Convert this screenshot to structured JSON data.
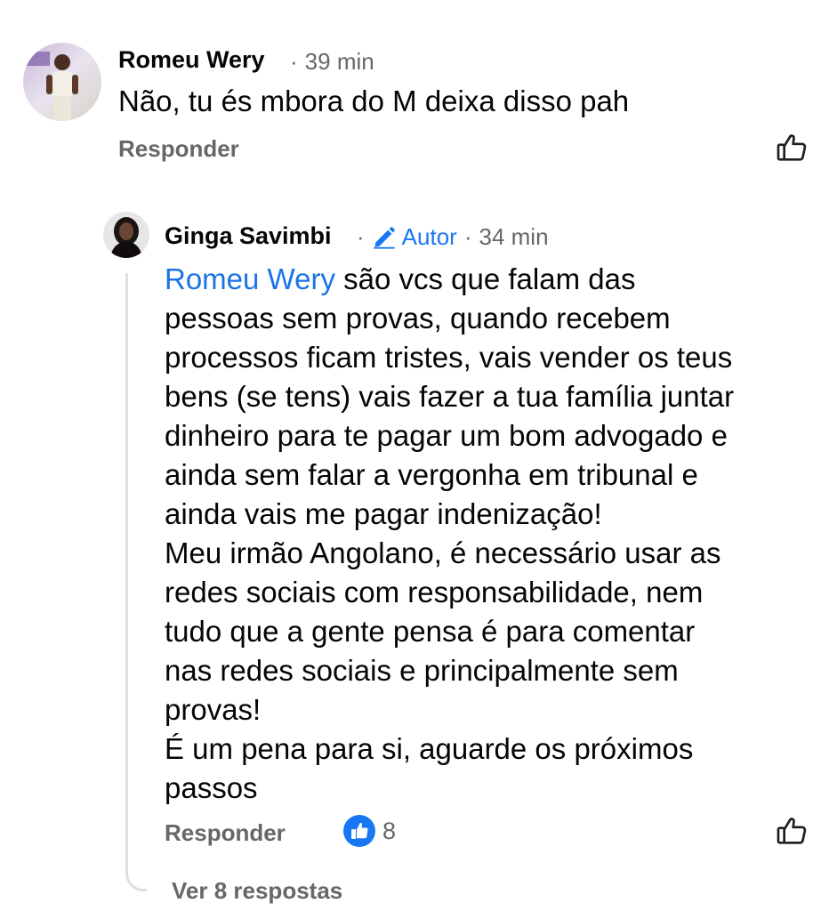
{
  "comment": {
    "author": "Romeu Wery",
    "time": "39 min",
    "text": "Não, tu és mbora do M deixa disso pah",
    "reply_label": "Responder",
    "icons": {
      "avatar": "avatar-photo",
      "like": "thumbs-up-icon"
    }
  },
  "reply": {
    "author": "Ginga Savimbi",
    "badge_label": "Autor",
    "time": "34 min",
    "mention": "Romeu Wery",
    "lines": [
      " são vcs que falam das",
      "pessoas sem provas, quando recebem",
      "processos ficam tristes, vais vender os teus",
      "bens (se tens) vais fazer a tua família juntar",
      "dinheiro para te pagar um bom advogado e",
      "ainda sem falar a vergonha em tribunal e",
      "ainda vais me pagar indenização!",
      "Meu irmão Angolano, é necessário usar as",
      "redes sociais com responsabilidade, nem",
      "tudo que a gente pensa é para comentar",
      "nas redes sociais e principalmente sem",
      "provas!",
      "É um pena para si, aguarde os próximos",
      "passos"
    ],
    "reply_label": "Responder",
    "like_count": "8",
    "icons": {
      "badge": "pencil-icon",
      "reaction": "like-reaction-icon",
      "like": "thumbs-up-icon"
    }
  },
  "view_replies": "Ver 8 respostas",
  "colors": {
    "text": "#050505",
    "secondary": "#65676b",
    "accent": "#1877f2",
    "mention": "#1b74e4",
    "thread_line": "#dcdfe3"
  }
}
